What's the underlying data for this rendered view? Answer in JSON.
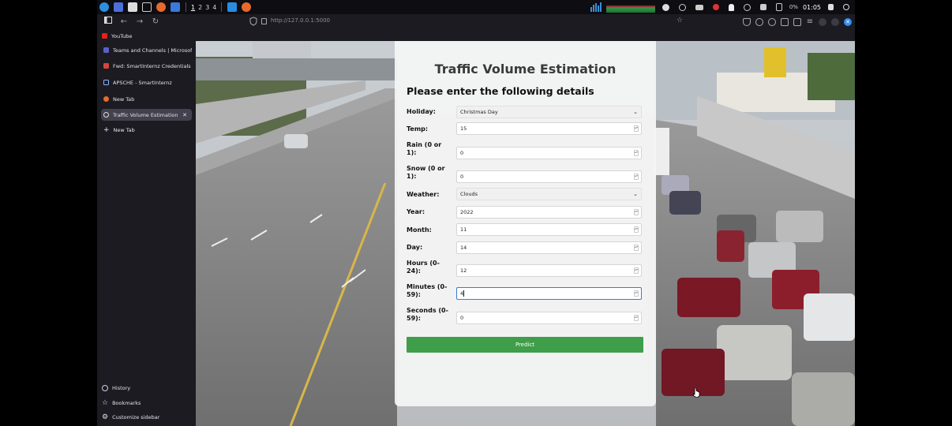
{
  "taskbar": {
    "workspaces": [
      "1",
      "2",
      "3",
      "4"
    ],
    "battery": "0%",
    "time": "01:05"
  },
  "browser": {
    "url": "http://127.0.0.1:5000"
  },
  "sidebar": {
    "pinned": "YouTube",
    "tabs": [
      {
        "label": "Teams and Channels | Microsof"
      },
      {
        "label": "Fwd: SmartInternz Credentials !"
      },
      {
        "label": "APSCHE - SmartInternz"
      },
      {
        "label": "New Tab"
      },
      {
        "label": "Traffic Volume Estimation"
      }
    ],
    "new_tab": "New Tab",
    "history": "History",
    "bookmarks": "Bookmarks",
    "customize": "Customize sidebar"
  },
  "form": {
    "title": "Traffic Volume Estimation",
    "subtitle": "Please enter the following details",
    "fields": {
      "holiday": {
        "label": "Holiday:",
        "value": "Christmas Day"
      },
      "temp": {
        "label": "Temp:",
        "value": "15"
      },
      "rain": {
        "label": "Rain (0 or 1):",
        "value": "0"
      },
      "snow": {
        "label": "Snow (0 or 1):",
        "value": "0"
      },
      "weather": {
        "label": "Weather:",
        "value": "Clouds"
      },
      "year": {
        "label": "Year:",
        "value": "2022"
      },
      "month": {
        "label": "Month:",
        "value": "11"
      },
      "day": {
        "label": "Day:",
        "value": "14"
      },
      "hours": {
        "label": "Hours (0-24):",
        "value": "12"
      },
      "minutes": {
        "label": "Minutes (0-59):",
        "value": "4"
      },
      "seconds": {
        "label": "Seconds (0-59):",
        "value": "0"
      }
    },
    "predict_label": "Predict"
  }
}
